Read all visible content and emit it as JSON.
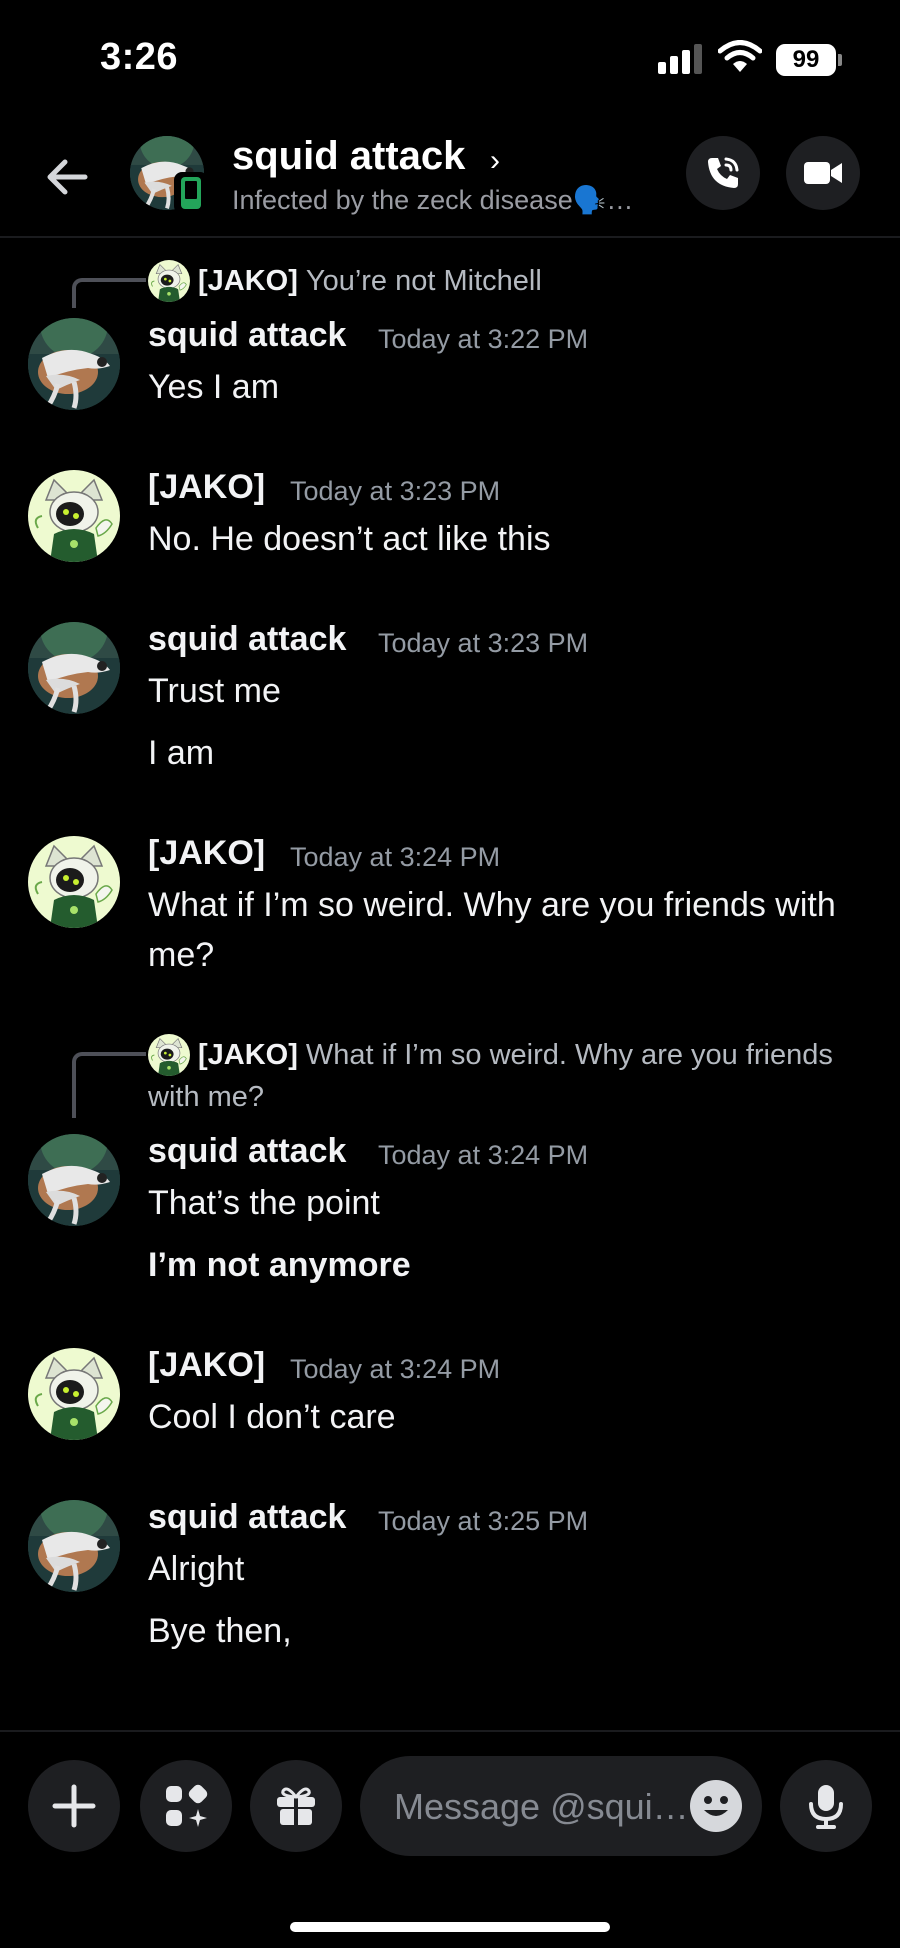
{
  "status_bar": {
    "time": "3:26",
    "battery": "99"
  },
  "header": {
    "back_icon": "arrow-left-icon",
    "title": "squid attack",
    "chevron": "›",
    "subtitle": "Infected by the zeck disease🗣️…",
    "call_icon": "phone-icon",
    "video_icon": "video-camera-icon"
  },
  "messages": [
    {
      "reply": {
        "author": "[JAKO]",
        "text": "You’re not Mitchell"
      },
      "author": "squid attack",
      "time": "Today at 3:22 PM",
      "lines": [
        "Yes I am"
      ]
    },
    {
      "author": "[JAKO]",
      "time": "Today at 3:23 PM",
      "lines": [
        "No. He doesn’t act like this"
      ]
    },
    {
      "author": "squid attack",
      "time": "Today at 3:23 PM",
      "lines": [
        "Trust me",
        "I am"
      ]
    },
    {
      "author": "[JAKO]",
      "time": "Today at 3:24 PM",
      "lines": [
        "What if I’m so weird. Why are you friends with me?"
      ]
    },
    {
      "reply": {
        "author": "[JAKO]",
        "text": "What if I’m so weird. Why are you friends with me?"
      },
      "author": "squid attack",
      "time": "Today at 3:24 PM",
      "lines": [
        "That’s the point",
        "I’m not anymore"
      ]
    },
    {
      "author": "[JAKO]",
      "time": "Today at 3:24 PM",
      "lines": [
        "Cool I don’t care"
      ]
    },
    {
      "author": "squid attack",
      "time": "Today at 3:25 PM",
      "lines": [
        "Alright",
        "Bye then,"
      ]
    }
  ],
  "composer": {
    "placeholder": "Message @squi…",
    "add_icon": "plus-icon",
    "apps_icon": "apps-icon",
    "gift_icon": "gift-icon",
    "emoji_icon": "emoji-icon",
    "mic_icon": "microphone-icon"
  },
  "colors": {
    "background": "#000000",
    "surface": "#1e1f22",
    "online": "#23a55a",
    "muted": "#949ba4"
  }
}
